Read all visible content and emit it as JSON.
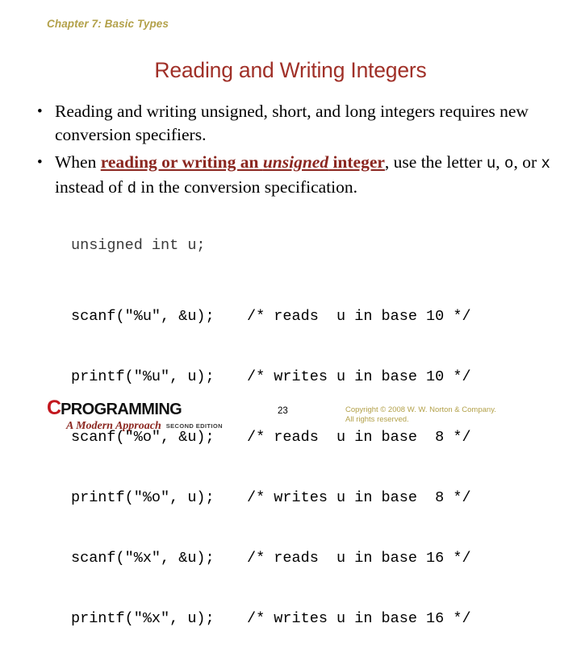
{
  "header": {
    "chapter_label": "Chapter 7: Basic Types"
  },
  "title": "Reading and Writing Integers",
  "bullets": [
    {
      "marker": "•",
      "segments": [
        {
          "text": "Reading and writing unsigned, short, and long integers requires new conversion specifiers.",
          "style": "plain"
        }
      ]
    },
    {
      "marker": "•",
      "segments": [
        {
          "text": "When ",
          "style": "plain"
        },
        {
          "text": "reading or writing an ",
          "style": "emph"
        },
        {
          "text": "unsigned",
          "style": "emph-italic"
        },
        {
          "text": " integer",
          "style": "emph"
        },
        {
          "text": ", use the letter ",
          "style": "plain"
        },
        {
          "text": "u",
          "style": "mono"
        },
        {
          "text": ", ",
          "style": "plain"
        },
        {
          "text": "o",
          "style": "mono"
        },
        {
          "text": ", or ",
          "style": "plain"
        },
        {
          "text": "x",
          "style": "mono"
        },
        {
          "text": " instead of ",
          "style": "plain"
        },
        {
          "text": "d",
          "style": "mono"
        },
        {
          "text": " in the conversion specification.",
          "style": "plain"
        }
      ]
    }
  ],
  "code": {
    "declaration": "unsigned int u;",
    "rows": [
      {
        "statement": "scanf(\"%u\", &u);",
        "comment": "/* reads  u in base 10 */"
      },
      {
        "statement": "printf(\"%u\", u);",
        "comment": "/* writes u in base 10 */"
      },
      {
        "statement": "scanf(\"%o\", &u);",
        "comment": "/* reads  u in base  8 */"
      },
      {
        "statement": "printf(\"%o\", u);",
        "comment": "/* writes u in base  8 */"
      },
      {
        "statement": "scanf(\"%x\", &u);",
        "comment": "/* reads  u in base 16 */"
      },
      {
        "statement": "printf(\"%x\", u);",
        "comment": "/* writes u in base 16 */"
      }
    ]
  },
  "footer": {
    "logo": {
      "c_letter": "C",
      "wordmark": "PROGRAMMING",
      "tagline": "A Modern Approach",
      "edition": "SECOND EDITION"
    },
    "page_number": "23",
    "copyright_line1": "Copyright © 2008 W. W. Norton & Company.",
    "copyright_line2": "All rights reserved."
  },
  "colors": {
    "title_red": "#a03028",
    "accent_olive": "#b3a14a",
    "emphasis_red": "#8b2720",
    "logo_red": "#c3171e",
    "background": "#ffffff"
  }
}
